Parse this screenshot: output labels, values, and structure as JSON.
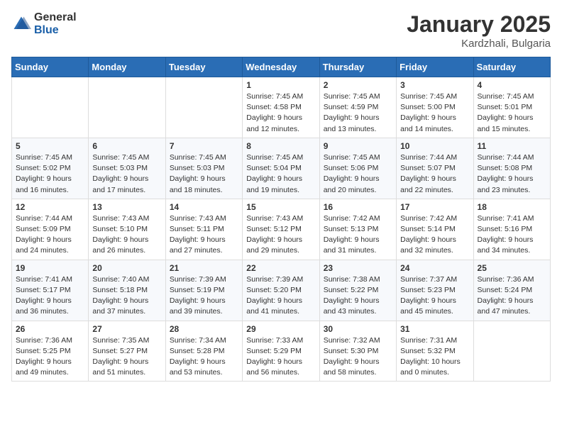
{
  "header": {
    "logo_general": "General",
    "logo_blue": "Blue",
    "title": "January 2025",
    "subtitle": "Kardzhali, Bulgaria"
  },
  "weekdays": [
    "Sunday",
    "Monday",
    "Tuesday",
    "Wednesday",
    "Thursday",
    "Friday",
    "Saturday"
  ],
  "weeks": [
    [
      {
        "day": "",
        "info": ""
      },
      {
        "day": "",
        "info": ""
      },
      {
        "day": "",
        "info": ""
      },
      {
        "day": "1",
        "info": "Sunrise: 7:45 AM\nSunset: 4:58 PM\nDaylight: 9 hours\nand 12 minutes."
      },
      {
        "day": "2",
        "info": "Sunrise: 7:45 AM\nSunset: 4:59 PM\nDaylight: 9 hours\nand 13 minutes."
      },
      {
        "day": "3",
        "info": "Sunrise: 7:45 AM\nSunset: 5:00 PM\nDaylight: 9 hours\nand 14 minutes."
      },
      {
        "day": "4",
        "info": "Sunrise: 7:45 AM\nSunset: 5:01 PM\nDaylight: 9 hours\nand 15 minutes."
      }
    ],
    [
      {
        "day": "5",
        "info": "Sunrise: 7:45 AM\nSunset: 5:02 PM\nDaylight: 9 hours\nand 16 minutes."
      },
      {
        "day": "6",
        "info": "Sunrise: 7:45 AM\nSunset: 5:03 PM\nDaylight: 9 hours\nand 17 minutes."
      },
      {
        "day": "7",
        "info": "Sunrise: 7:45 AM\nSunset: 5:03 PM\nDaylight: 9 hours\nand 18 minutes."
      },
      {
        "day": "8",
        "info": "Sunrise: 7:45 AM\nSunset: 5:04 PM\nDaylight: 9 hours\nand 19 minutes."
      },
      {
        "day": "9",
        "info": "Sunrise: 7:45 AM\nSunset: 5:06 PM\nDaylight: 9 hours\nand 20 minutes."
      },
      {
        "day": "10",
        "info": "Sunrise: 7:44 AM\nSunset: 5:07 PM\nDaylight: 9 hours\nand 22 minutes."
      },
      {
        "day": "11",
        "info": "Sunrise: 7:44 AM\nSunset: 5:08 PM\nDaylight: 9 hours\nand 23 minutes."
      }
    ],
    [
      {
        "day": "12",
        "info": "Sunrise: 7:44 AM\nSunset: 5:09 PM\nDaylight: 9 hours\nand 24 minutes."
      },
      {
        "day": "13",
        "info": "Sunrise: 7:43 AM\nSunset: 5:10 PM\nDaylight: 9 hours\nand 26 minutes."
      },
      {
        "day": "14",
        "info": "Sunrise: 7:43 AM\nSunset: 5:11 PM\nDaylight: 9 hours\nand 27 minutes."
      },
      {
        "day": "15",
        "info": "Sunrise: 7:43 AM\nSunset: 5:12 PM\nDaylight: 9 hours\nand 29 minutes."
      },
      {
        "day": "16",
        "info": "Sunrise: 7:42 AM\nSunset: 5:13 PM\nDaylight: 9 hours\nand 31 minutes."
      },
      {
        "day": "17",
        "info": "Sunrise: 7:42 AM\nSunset: 5:14 PM\nDaylight: 9 hours\nand 32 minutes."
      },
      {
        "day": "18",
        "info": "Sunrise: 7:41 AM\nSunset: 5:16 PM\nDaylight: 9 hours\nand 34 minutes."
      }
    ],
    [
      {
        "day": "19",
        "info": "Sunrise: 7:41 AM\nSunset: 5:17 PM\nDaylight: 9 hours\nand 36 minutes."
      },
      {
        "day": "20",
        "info": "Sunrise: 7:40 AM\nSunset: 5:18 PM\nDaylight: 9 hours\nand 37 minutes."
      },
      {
        "day": "21",
        "info": "Sunrise: 7:39 AM\nSunset: 5:19 PM\nDaylight: 9 hours\nand 39 minutes."
      },
      {
        "day": "22",
        "info": "Sunrise: 7:39 AM\nSunset: 5:20 PM\nDaylight: 9 hours\nand 41 minutes."
      },
      {
        "day": "23",
        "info": "Sunrise: 7:38 AM\nSunset: 5:22 PM\nDaylight: 9 hours\nand 43 minutes."
      },
      {
        "day": "24",
        "info": "Sunrise: 7:37 AM\nSunset: 5:23 PM\nDaylight: 9 hours\nand 45 minutes."
      },
      {
        "day": "25",
        "info": "Sunrise: 7:36 AM\nSunset: 5:24 PM\nDaylight: 9 hours\nand 47 minutes."
      }
    ],
    [
      {
        "day": "26",
        "info": "Sunrise: 7:36 AM\nSunset: 5:25 PM\nDaylight: 9 hours\nand 49 minutes."
      },
      {
        "day": "27",
        "info": "Sunrise: 7:35 AM\nSunset: 5:27 PM\nDaylight: 9 hours\nand 51 minutes."
      },
      {
        "day": "28",
        "info": "Sunrise: 7:34 AM\nSunset: 5:28 PM\nDaylight: 9 hours\nand 53 minutes."
      },
      {
        "day": "29",
        "info": "Sunrise: 7:33 AM\nSunset: 5:29 PM\nDaylight: 9 hours\nand 56 minutes."
      },
      {
        "day": "30",
        "info": "Sunrise: 7:32 AM\nSunset: 5:30 PM\nDaylight: 9 hours\nand 58 minutes."
      },
      {
        "day": "31",
        "info": "Sunrise: 7:31 AM\nSunset: 5:32 PM\nDaylight: 10 hours\nand 0 minutes."
      },
      {
        "day": "",
        "info": ""
      }
    ]
  ]
}
